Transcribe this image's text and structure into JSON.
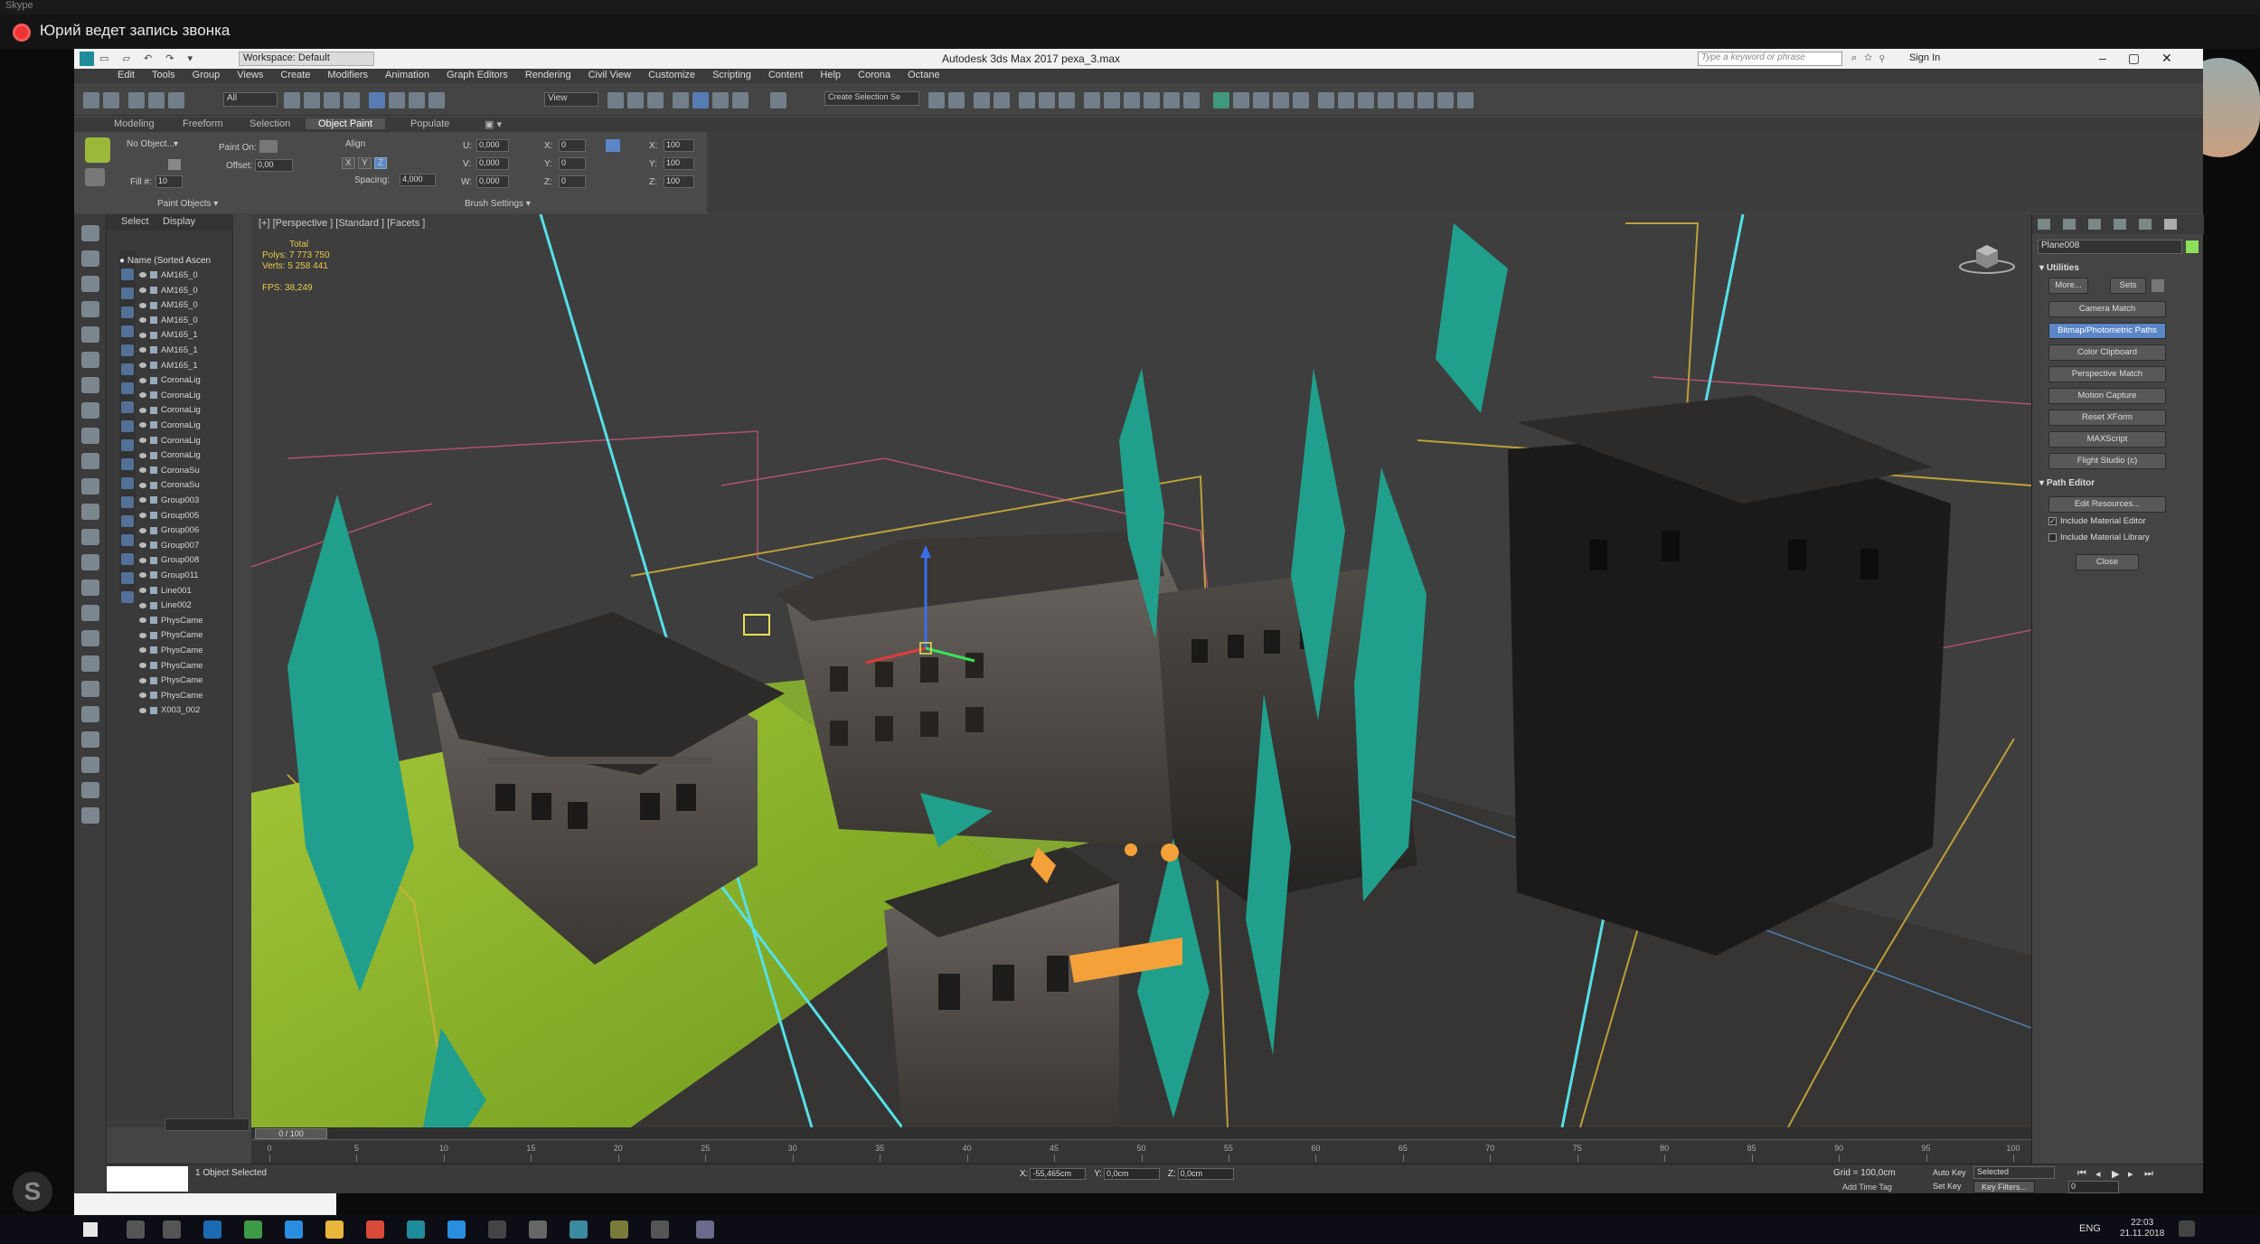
{
  "skype": {
    "app_name": "Skype",
    "recording_text": "Юрий ведет запись звонка"
  },
  "window": {
    "title": "Autodesk 3ds Max 2017    реха_3.max",
    "workspace": "Workspace: Default",
    "search_placeholder": "Type a keyword or phrase",
    "sign_in": "Sign In"
  },
  "menu": [
    "Edit",
    "Tools",
    "Group",
    "Views",
    "Create",
    "Modifiers",
    "Animation",
    "Graph Editors",
    "Rendering",
    "Civil View",
    "Customize",
    "Scripting",
    "Content",
    "Help",
    "Corona",
    "Octane"
  ],
  "toolbar": {
    "selection_filter": "All",
    "view_dropdown": "View",
    "create_selection_set": "Create Selection Se"
  },
  "ribbon": {
    "tabs": [
      "Modeling",
      "Freeform",
      "Selection",
      "Object Paint",
      "Populate"
    ],
    "active_tab": "Object Paint",
    "no_object": "No Object...",
    "paint_on": "Paint On:",
    "offset_label": "Offset:",
    "offset_value": "0,00",
    "fill_label": "Fill #:",
    "fill_value": "10",
    "align_label": "Align",
    "axis_x": "X",
    "axis_y": "Y",
    "axis_z": "Z",
    "spacing_label": "Spacing:",
    "spacing_value": "4,000",
    "u_label": "U:",
    "u_value": "0,000",
    "v_label": "V:",
    "v_value": "0,000",
    "w_label": "W:",
    "w_value": "0,000",
    "x_label": "X:",
    "x_value": "0",
    "y_label": "Y:",
    "y_value": "0",
    "z_label": "Z:",
    "z_value": "0",
    "sx_label": "X:",
    "sx_value": "100",
    "sy_label": "Y:",
    "sy_value": "100",
    "sz_label": "Z:",
    "sz_value": "100",
    "paint_objects": "Paint Objects ▾",
    "brush_settings": "Brush Settings ▾"
  },
  "scene_explorer": {
    "tabs": [
      "Select",
      "Display"
    ],
    "header": "Name (Sorted Ascen",
    "items": [
      "AM165_0",
      "AM165_0",
      "AM165_0",
      "AM165_0",
      "AM165_1",
      "AM165_1",
      "AM165_1",
      "CoronaLig",
      "CoronaLig",
      "CoronaLig",
      "CoronaLig",
      "CoronaLig",
      "CoronaLig",
      "CoronaSu",
      "CoronaSu",
      "Group003",
      "Group005",
      "Group006",
      "Group007",
      "Group008",
      "Group011",
      "Line001",
      "Line002",
      "PhysCame",
      "PhysCame",
      "PhysCame",
      "PhysCame",
      "PhysCame",
      "PhysCame",
      "X003_002"
    ]
  },
  "viewport": {
    "label": "[+] [Perspective ] [Standard ] [Facets ]",
    "stats_total": "Total",
    "stats_polys_label": "Polys:",
    "stats_polys": "7 773 750",
    "stats_verts_label": "Verts:",
    "stats_verts": "5 258 441",
    "stats_fps_label": "FPS:",
    "stats_fps": "38,249"
  },
  "command_panel": {
    "object_name": "Plane008",
    "utilities_title": "Utilities",
    "more_button": "More...",
    "sets_button": "Sets",
    "buttons": [
      "Camera Match",
      "Bitmap/Photometric Paths",
      "Color Clipboard",
      "Perspective Match",
      "Motion Capture",
      "Reset XForm",
      "MAXScript",
      "Flight Studio (c)"
    ],
    "active_button": "Bitmap/Photometric Paths",
    "path_editor_title": "Path Editor",
    "edit_resources": "Edit Resources...",
    "include_material_editor": "Include Material Editor",
    "include_material_library": "Include Material Library",
    "close_button": "Close"
  },
  "timeline": {
    "position": "0 / 100",
    "ticks": [
      "0",
      "5",
      "10",
      "15",
      "20",
      "25",
      "30",
      "35",
      "40",
      "45",
      "50",
      "55",
      "60",
      "65",
      "70",
      "75",
      "80",
      "85",
      "90",
      "95",
      "100"
    ]
  },
  "status": {
    "message": "1 Object Selected",
    "x_label": "X:",
    "x_value": "-55,465cm",
    "y_label": "Y:",
    "y_value": "0,0cm",
    "z_label": "Z:",
    "z_value": "0,0cm",
    "grid": "Grid = 100,0cm",
    "add_time_tag": "Add Time Tag",
    "auto_key": "Auto Key",
    "selected": "Selected",
    "set_key": "Set Key",
    "key_filters": "Key Filters...",
    "frame": "0"
  },
  "taskbar": {
    "lang": "ENG",
    "time": "22:03",
    "date": "21.11.2018"
  },
  "colors": {
    "tree_teal": "#20a08c",
    "cyan_line": "#55e0e8",
    "ground_green": "#8fbf2a",
    "viewport_bg": "#3e3e3e",
    "active_blue": "#5b86c7"
  }
}
